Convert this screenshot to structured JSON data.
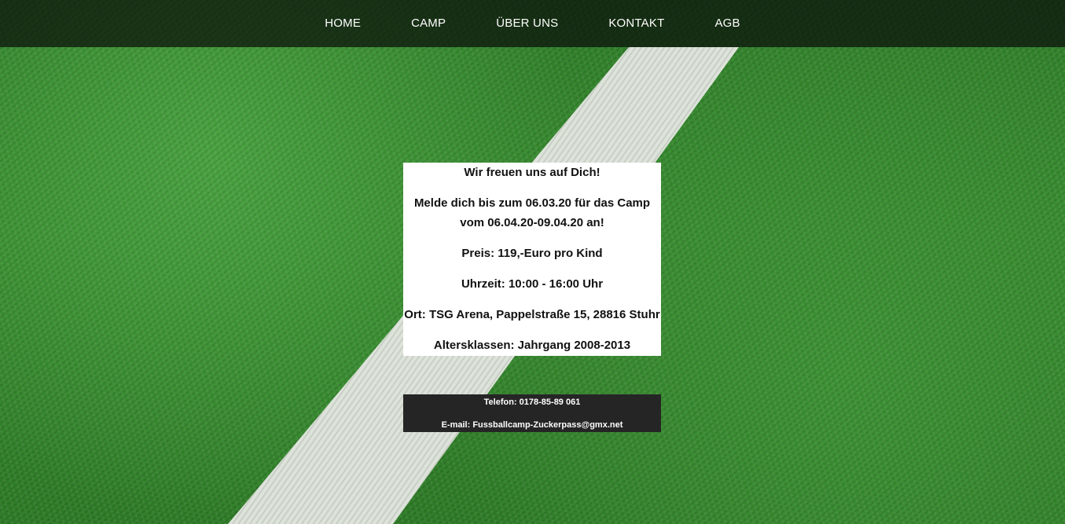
{
  "nav": {
    "items": [
      {
        "label": "HOME"
      },
      {
        "label": "CAMP"
      },
      {
        "label": "ÜBER UNS"
      },
      {
        "label": "KONTAKT"
      },
      {
        "label": "AGB"
      }
    ]
  },
  "info": {
    "greeting": "Wir freuen uns auf Dich!",
    "signup_line1": "Melde dich bis zum 06.03.20 für das Camp",
    "signup_line2": "vom 06.04.20-09.04.20 an!",
    "price": "Preis: 119,-Euro pro Kind",
    "time": "Uhrzeit: 10:00 - 16:00 Uhr",
    "location": "Ort: TSG Arena, Pappelstraße 15, 28816 Stuhr",
    "age_groups": "Altersklassen: Jahrgang 2008-2013"
  },
  "contact": {
    "phone": "Telefon: 0178-85-89 061",
    "email": "E-mail: Fussballcamp-Zuckerpass@gmx.net"
  },
  "colors": {
    "nav_background": "#0a0e0a",
    "turf_green": "#37892f",
    "field_line": "#e9ebe8",
    "info_background": "#ffffff",
    "contact_background": "#262526"
  }
}
